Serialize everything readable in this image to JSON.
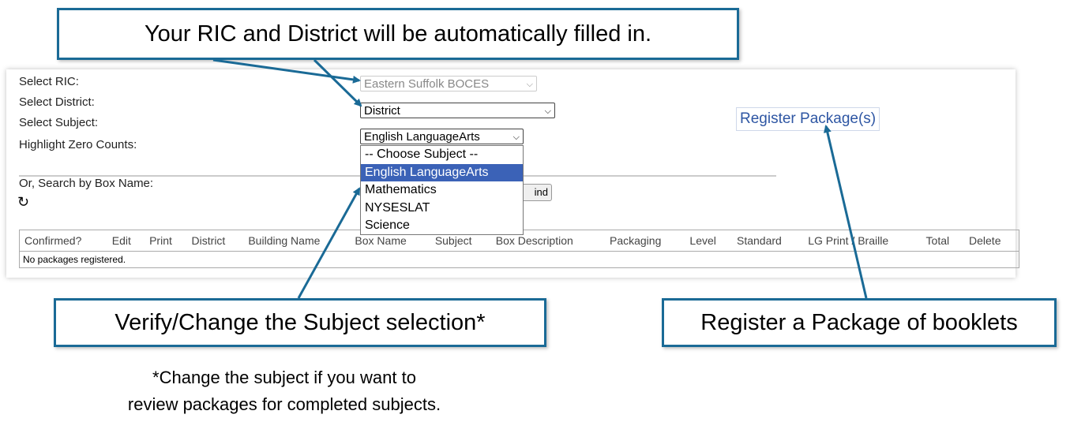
{
  "callouts": {
    "top": "Your RIC and District will be automatically filled in.",
    "subject": "Verify/Change the Subject selection*",
    "register": "Register a Package of booklets"
  },
  "footnote": {
    "line1": "*Change the subject if you want to",
    "line2": "review packages for completed subjects."
  },
  "form": {
    "ric_label": "Select RIC:",
    "ric_value": "Eastern Suffolk BOCES",
    "district_label": "Select District:",
    "district_value": "District",
    "subject_label": "Select Subject:",
    "subject_value": "English LanguageArts",
    "highlight_label": "Highlight Zero Counts:",
    "search_label": "Or, Search by Box Name:",
    "find_button": "ind",
    "reload_icon": "↻"
  },
  "subject_options": [
    "-- Choose Subject --",
    "English LanguageArts",
    "Mathematics",
    "NYSESLAT",
    "Science"
  ],
  "selected_option_index": 1,
  "register_link": "Register Package(s)",
  "table": {
    "columns": [
      "Confirmed?",
      "Edit",
      "Print",
      "District",
      "Building Name",
      "Box Name",
      "Subject",
      "Box Description",
      "Packaging",
      "Level",
      "Standard",
      "LG Print / Braille",
      "Total",
      "Delete"
    ],
    "empty_message": "No packages registered."
  },
  "colors": {
    "callout_border": "#1a6a96",
    "arrow": "#1a6a96",
    "link": "#2e56a3",
    "selected_option": "#3b62b7"
  }
}
